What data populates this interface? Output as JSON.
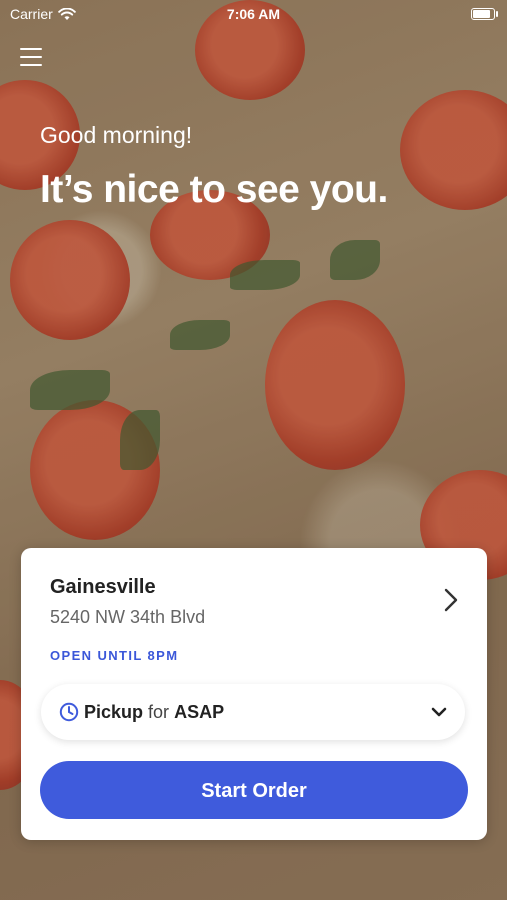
{
  "status_bar": {
    "carrier": "Carrier",
    "time": "7:06 AM"
  },
  "hero": {
    "greeting": "Good morning!",
    "headline": "It’s nice to see you."
  },
  "store": {
    "name": "Gainesville",
    "address": "5240 NW 34th Blvd",
    "status": "OPEN UNTIL 8PM"
  },
  "order": {
    "mode": "Pickup",
    "connector": "for",
    "time": "ASAP",
    "start_label": "Start Order"
  },
  "colors": {
    "accent": "#3f5bdc",
    "status_text": "#3b57d9"
  },
  "icons": [
    "wifi-icon",
    "battery-icon",
    "menu-icon",
    "chevron-right-icon",
    "clock-icon",
    "chevron-down-icon"
  ]
}
